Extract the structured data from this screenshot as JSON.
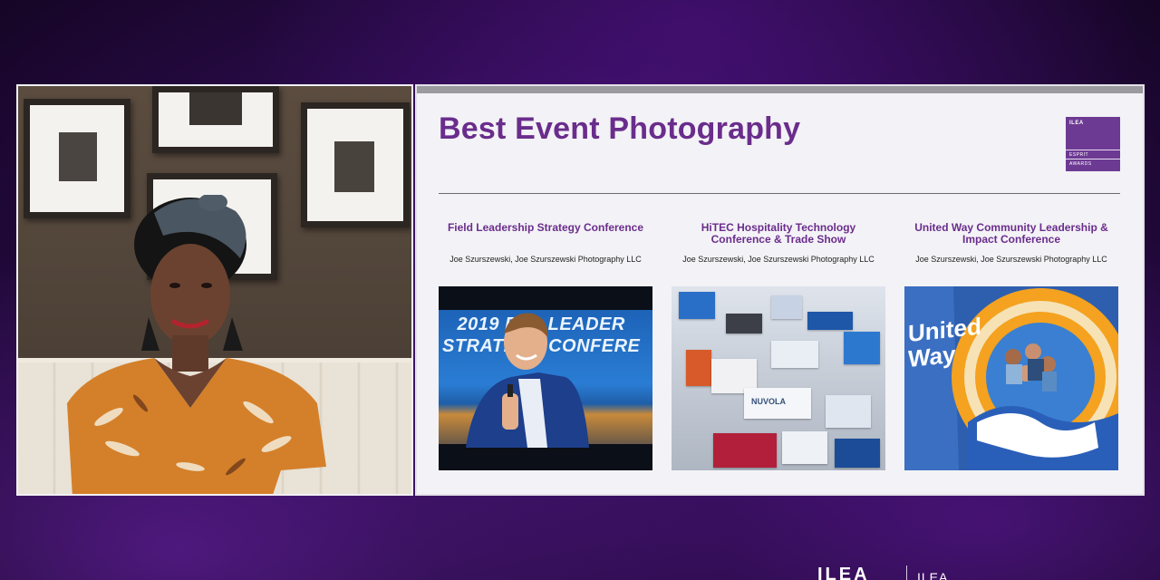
{
  "slide": {
    "title": "Best Event Photography",
    "logo": {
      "top_text": "ILEA",
      "mid_text": "ESPRIT",
      "bottom_text": "AWARDS",
      "color": "#6d3a93"
    },
    "entries": [
      {
        "title": "Field Leadership Strategy Conference",
        "credit": "Joe Szurszewski, Joe Szurszewski Photography LLC",
        "photo_text": "2019 ELD LEADER\nSTRATEGY CONFERE"
      },
      {
        "title": "HiTEC Hospitality Technology Conference & Trade Show",
        "credit": "Joe Szurszewski, Joe Szurszewski Photography LLC",
        "photo_text": "NUVOLA"
      },
      {
        "title": "United Way Community Leadership & Impact Conference",
        "credit": "Joe Szurszewski, Joe Szurszewski Photography LLC",
        "photo_text": "United Way"
      }
    ]
  },
  "brand": {
    "mark": "ILEA",
    "sub": "ILEA"
  },
  "colors": {
    "accent": "#6a2d8c",
    "background": "#2a0b4a",
    "slide_bg": "#f3f2f6"
  }
}
